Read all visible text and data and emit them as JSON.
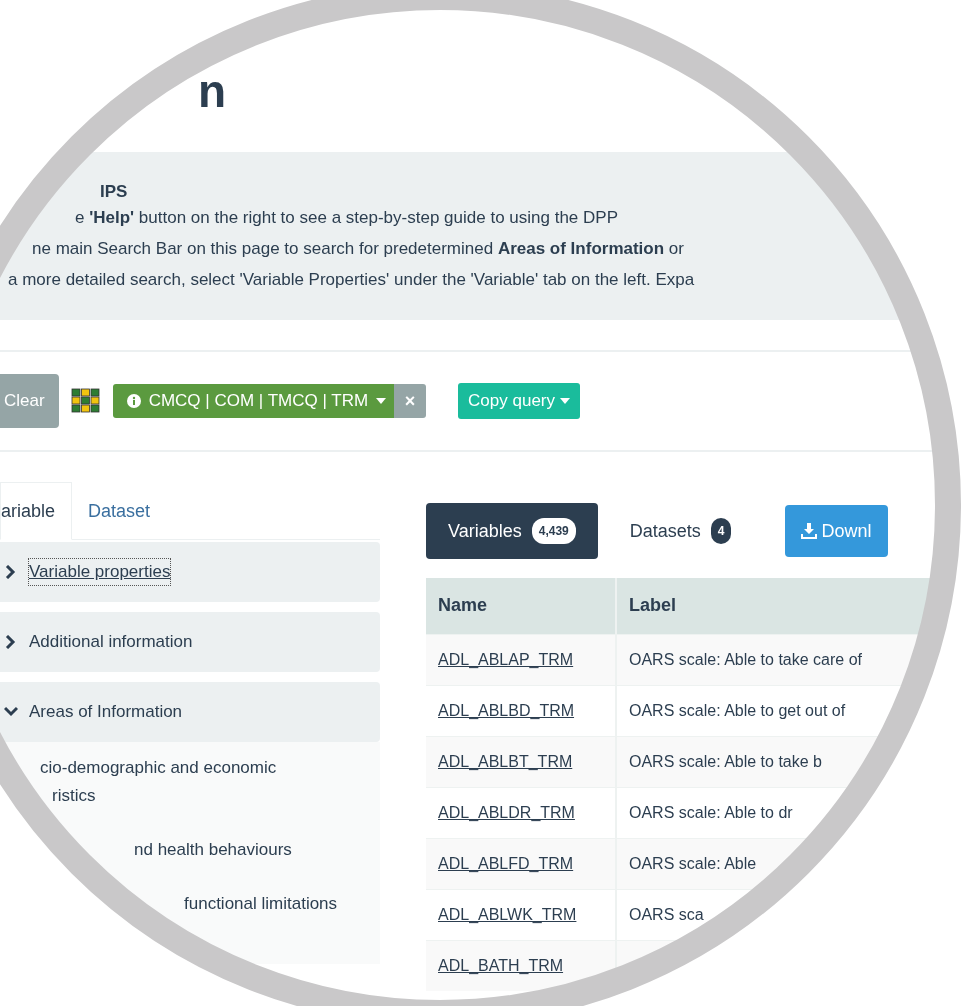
{
  "page_title": "n",
  "tips": {
    "heading": "IPS",
    "lines": [
      "e **'Help'** button on the right to see a step-by-step guide to using the DPP",
      "ne main Search Bar on this page to search for predetermined **Areas of Information** or",
      "a more detailed search, select 'Variable Properties' under the 'Variable' tab on the left. Expa"
    ]
  },
  "toolbar": {
    "clear_button": "Clear",
    "filter": {
      "label": "CMCQ | COM | TMCQ | TRM",
      "remove": "×"
    },
    "copy_button": "Copy query"
  },
  "left_tabs": [
    {
      "label": "ariable",
      "selected": true
    },
    {
      "label": "Dataset",
      "selected": false
    }
  ],
  "sections": [
    {
      "label": "Variable properties",
      "expanded": false,
      "focused": true
    },
    {
      "label": "Additional information",
      "expanded": false,
      "focused": false
    },
    {
      "label": "Areas of Information",
      "expanded": true,
      "focused": false,
      "children": [
        {
          "lines": [
            "cio-demographic and economic",
            "ristics"
          ]
        },
        {
          "lines": [
            "nd health behaviours"
          ]
        },
        {
          "lines": [
            "functional limitations"
          ]
        }
      ]
    }
  ],
  "result_tabs": [
    {
      "label": "Variables",
      "count": "4,439",
      "selected": true
    },
    {
      "label": "Datasets",
      "count": "4",
      "selected": false
    }
  ],
  "download_button": "Downl",
  "table": {
    "columns": [
      "Name",
      "Label"
    ],
    "rows": [
      {
        "name": "ADL_ABLAP_TRM",
        "label": "OARS scale: Able to take care of"
      },
      {
        "name": "ADL_ABLBD_TRM",
        "label": "OARS scale: Able to get out of"
      },
      {
        "name": "ADL_ABLBT_TRM",
        "label": "OARS scale: Able to take b"
      },
      {
        "name": "ADL_ABLDR_TRM",
        "label": "OARS scale: Able to dr"
      },
      {
        "name": "ADL_ABLFD_TRM",
        "label": "OARS scale: Able"
      },
      {
        "name": "ADL_ABLWK_TRM",
        "label": "OARS sca"
      },
      {
        "name": "ADL_BATH_TRM"
      }
    ]
  }
}
